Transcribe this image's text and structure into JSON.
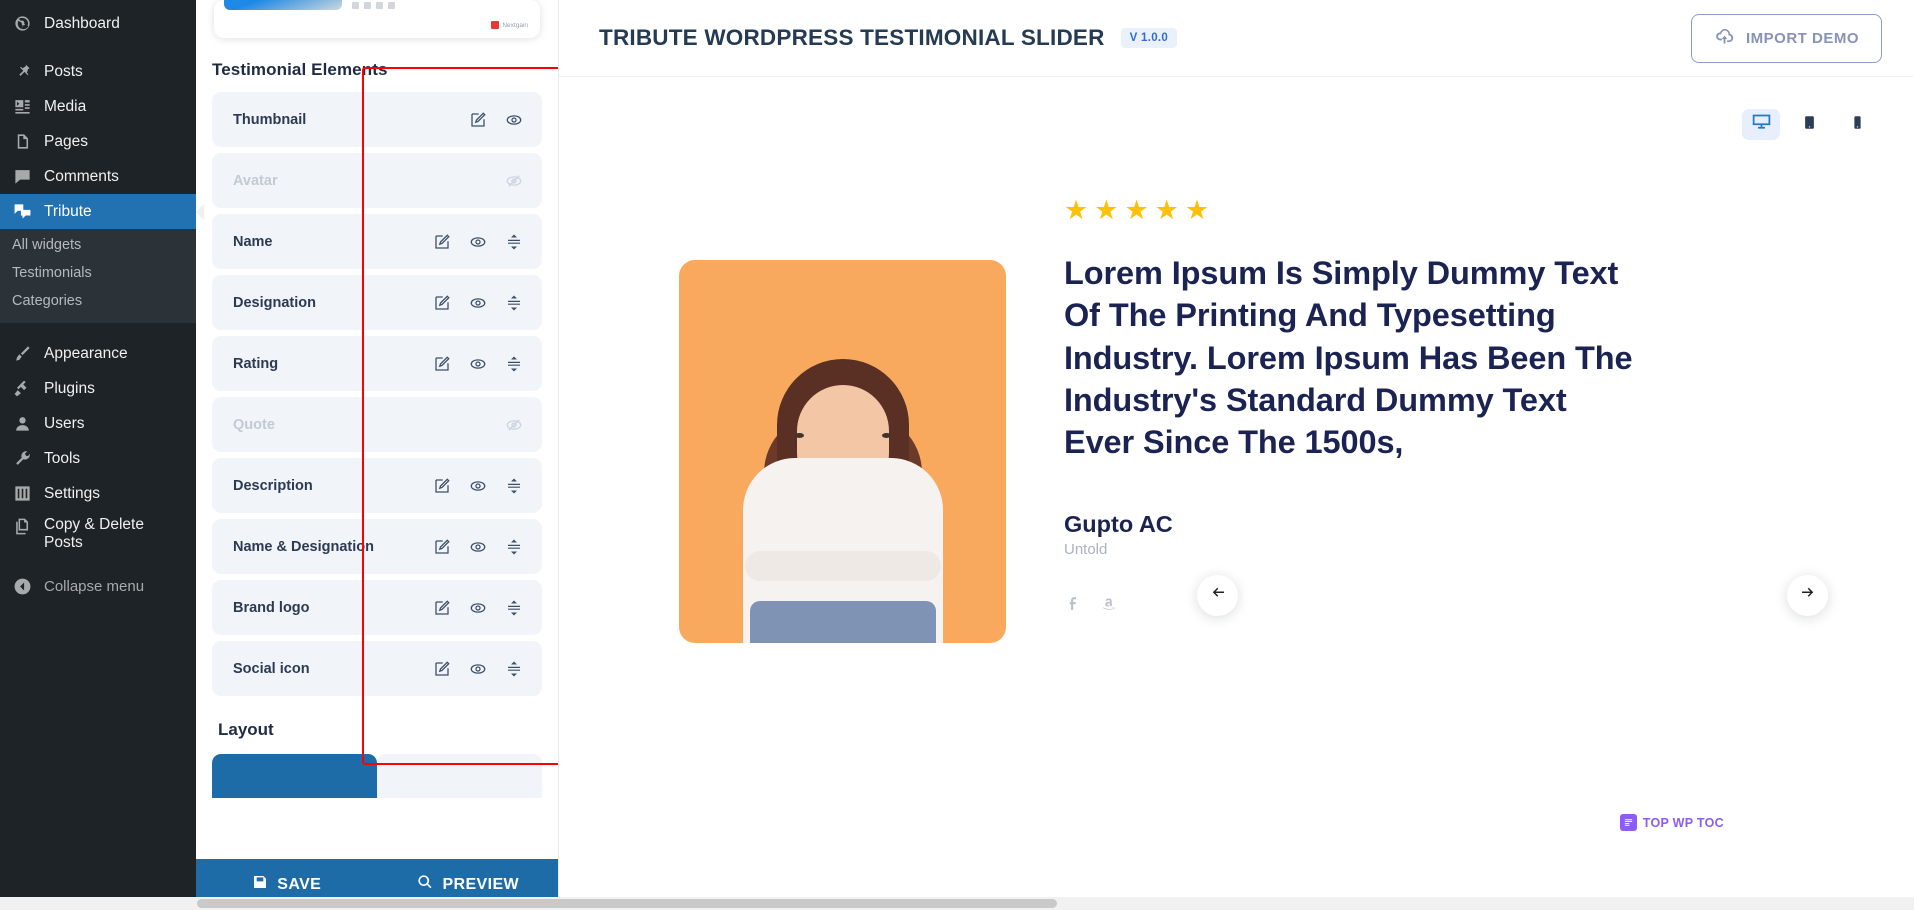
{
  "wp_sidebar": {
    "items": [
      {
        "label": "Dashboard",
        "icon": "dashboard-icon",
        "active": false
      },
      {
        "label": "Posts",
        "icon": "pin-icon",
        "active": false
      },
      {
        "label": "Media",
        "icon": "media-icon",
        "active": false
      },
      {
        "label": "Pages",
        "icon": "pages-icon",
        "active": false
      },
      {
        "label": "Comments",
        "icon": "comments-icon",
        "active": false
      },
      {
        "label": "Tribute",
        "icon": "tribute-icon",
        "active": true
      },
      {
        "label": "Appearance",
        "icon": "brush-icon",
        "active": false
      },
      {
        "label": "Plugins",
        "icon": "plug-icon",
        "active": false
      },
      {
        "label": "Users",
        "icon": "user-icon",
        "active": false
      },
      {
        "label": "Tools",
        "icon": "wrench-icon",
        "active": false
      },
      {
        "label": "Settings",
        "icon": "sliders-icon",
        "active": false
      },
      {
        "label": "Copy & Delete Posts",
        "icon": "copy-icon",
        "active": false
      }
    ],
    "submenu": [
      "All widgets",
      "Testimonials",
      "Categories"
    ],
    "collapse_label": "Collapse menu",
    "collapse_icon": "collapse-arrow-icon"
  },
  "panel": {
    "section_title": "Testimonial Elements",
    "layout_title": "Layout",
    "elements": [
      {
        "label": "Thumbnail",
        "enabled": true,
        "actions": [
          "edit-icon",
          "eye-icon"
        ]
      },
      {
        "label": "Avatar",
        "enabled": false,
        "actions": [
          "eye-off-icon"
        ]
      },
      {
        "label": "Name",
        "enabled": true,
        "actions": [
          "edit-icon",
          "eye-icon",
          "drag-handle-icon"
        ]
      },
      {
        "label": "Designation",
        "enabled": true,
        "actions": [
          "edit-icon",
          "eye-icon",
          "drag-handle-icon"
        ]
      },
      {
        "label": "Rating",
        "enabled": true,
        "actions": [
          "edit-icon",
          "eye-icon",
          "drag-handle-icon"
        ]
      },
      {
        "label": "Quote",
        "enabled": false,
        "actions": [
          "eye-off-icon"
        ]
      },
      {
        "label": "Description",
        "enabled": true,
        "actions": [
          "edit-icon",
          "eye-icon",
          "drag-handle-icon"
        ]
      },
      {
        "label": "Name & Designation",
        "enabled": true,
        "actions": [
          "edit-icon",
          "eye-icon",
          "drag-handle-icon"
        ]
      },
      {
        "label": "Brand logo",
        "enabled": true,
        "actions": [
          "edit-icon",
          "eye-icon",
          "drag-handle-icon"
        ]
      },
      {
        "label": "Social icon",
        "enabled": true,
        "actions": [
          "edit-icon",
          "eye-icon",
          "drag-handle-icon"
        ]
      }
    ],
    "save_label": "SAVE",
    "preview_label": "PREVIEW",
    "save_icon": "floppy-disk-icon",
    "preview_icon": "magnifier-icon"
  },
  "topbar": {
    "title": "TRIBUTE WORDPRESS TESTIMONIAL SLIDER",
    "version": "V 1.0.0",
    "import_label": "IMPORT DEMO",
    "import_icon": "cloud-download-icon"
  },
  "devices": [
    {
      "name": "desktop",
      "icon": "desktop-icon",
      "active": true
    },
    {
      "name": "tablet",
      "icon": "tablet-icon",
      "active": false
    },
    {
      "name": "mobile",
      "icon": "mobile-icon",
      "active": false
    }
  ],
  "slide": {
    "rating": 5,
    "star_glyph": "★",
    "quote": "Lorem Ipsum Is Simply Dummy Text Of The Printing And Typesetting Industry. Lorem Ipsum Has Been The Industry's Standard Dummy Text Ever Since The 1500s,",
    "author_name": "Gupto AC",
    "author_designation": "Untold",
    "socials": [
      "facebook-icon",
      "amazon-icon"
    ],
    "prev_icon": "arrow-left-icon",
    "next_icon": "arrow-right-icon",
    "photo_bg": "#f8a95e"
  },
  "toc_badge": {
    "label": "TOP WP TOC",
    "icon": "list-icon",
    "color": "#8b5cf6"
  },
  "colors": {
    "wp_sidebar_bg": "#1d2327",
    "wp_active": "#2271b1",
    "accent_blue": "#1d6ca8",
    "row_bg": "#f1f4f9",
    "heading": "#1b2352",
    "star": "#ffc107",
    "highlight_border": "#fe0000"
  }
}
